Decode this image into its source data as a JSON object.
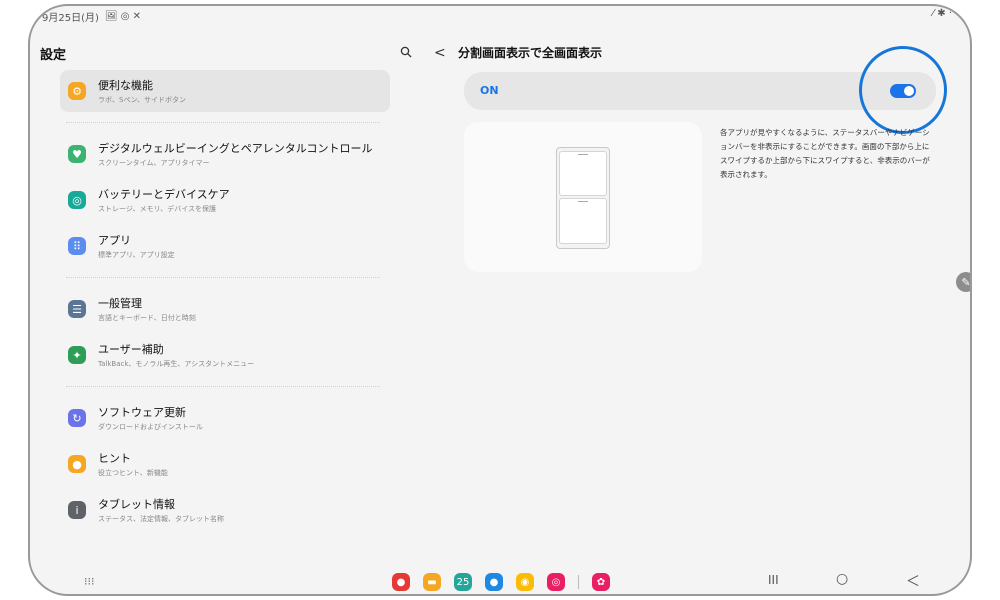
{
  "status": {
    "time": "9月25日(月)",
    "icons": "🖼 ◎ ✕",
    "right": "⁄ ✱ ·"
  },
  "left": {
    "title": "設定",
    "items": [
      {
        "label": "便利な機能",
        "sub": "ラボ、Sペン、サイドボタン",
        "icon": "gear-icon",
        "color": "#f5a623",
        "selected": true
      },
      {
        "divider": true
      },
      {
        "label": "デジタルウェルビーイングとペアレンタルコントロール",
        "sub": "スクリーンタイム、アプリタイマー",
        "icon": "wellbeing-icon",
        "color": "#3cb371"
      },
      {
        "label": "バッテリーとデバイスケア",
        "sub": "ストレージ、メモリ、デバイスを保護",
        "icon": "battery-care-icon",
        "color": "#18a999"
      },
      {
        "label": "アプリ",
        "sub": "標準アプリ、アプリ設定",
        "icon": "apps-icon",
        "color": "#5b8def"
      },
      {
        "divider": true
      },
      {
        "label": "一般管理",
        "sub": "言語とキーボード、日付と時刻",
        "icon": "sliders-icon",
        "color": "#5a7694"
      },
      {
        "label": "ユーザー補助",
        "sub": "TalkBack、モノラル再生、アシスタントメニュー",
        "icon": "accessibility-icon",
        "color": "#2e9e57"
      },
      {
        "divider": true
      },
      {
        "label": "ソフトウェア更新",
        "sub": "ダウンロードおよびインストール",
        "icon": "update-icon",
        "color": "#6b73e8"
      },
      {
        "label": "ヒント",
        "sub": "役立つヒント、新機能",
        "icon": "lightbulb-icon",
        "color": "#f5a623"
      },
      {
        "label": "タブレット情報",
        "sub": "ステータス、法定情報、タブレット名称",
        "icon": "info-icon",
        "color": "#5f6368"
      }
    ]
  },
  "right": {
    "title": "分割画面表示で全画面表示",
    "switch_label": "ON",
    "switch_state": true,
    "description": "各アプリが見やすくなるように、ステータスバーやナビゲーションバーを非表示にすることができます。画面の下部から上にスワイプするか上部から下にスワイプすると、非表示のバーが表示されます。"
  },
  "nav": {
    "apps": "⁝⁝⁝",
    "recent": "III",
    "home": "○",
    "back": "＜"
  },
  "dock": [
    {
      "name": "red-app-icon",
      "color": "#e53935",
      "glyph": "●"
    },
    {
      "name": "folder-app-icon",
      "color": "#f5a623",
      "glyph": "▬"
    },
    {
      "name": "calendar-app-icon",
      "color": "#26a69a",
      "glyph": "25"
    },
    {
      "name": "messages-app-icon",
      "color": "#1e88e5",
      "glyph": "●"
    },
    {
      "name": "chrome-app-icon",
      "color": "#fbbc05",
      "glyph": "◉"
    },
    {
      "name": "camera-app-icon",
      "color": "#e91e63",
      "glyph": "◎"
    },
    {
      "name": "gallery-app-icon",
      "color": "#e91e63",
      "glyph": "✿"
    }
  ]
}
